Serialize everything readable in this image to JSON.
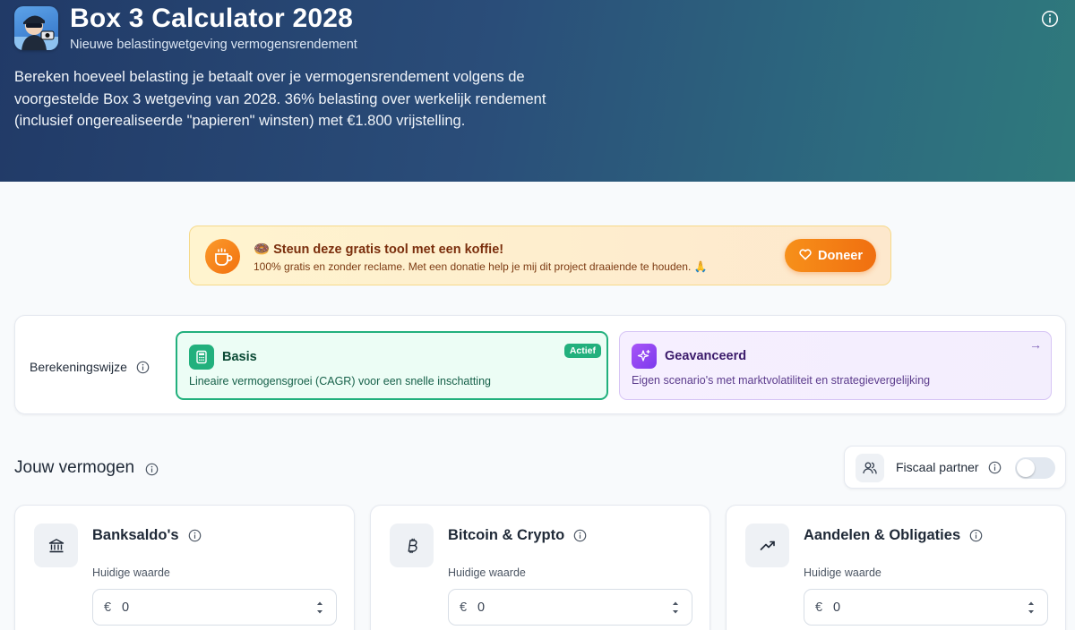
{
  "header": {
    "title": "Box 3 Calculator 2028",
    "subtitle": "Nieuwe belastingwetgeving vermogensrendement",
    "description": "Bereken hoeveel belasting je betaalt over je vermogensrendement volgens de voorgestelde Box 3 wetgeving van 2028. 36% belasting over werkelijk rendement (inclusief ongerealiseerde \"papieren\" winsten) met €1.800 vrijstelling."
  },
  "donation": {
    "title": "🍩 Steun deze gratis tool met een koffie!",
    "text": "100% gratis en zonder reclame. Met een donatie help je mij dit project draaiende te houden. 🙏",
    "button_label": "Doneer"
  },
  "mode": {
    "label": "Berekeningswijze",
    "options": [
      {
        "title": "Basis",
        "description": "Lineaire vermogensgroei (CAGR) voor een snelle inschatting",
        "badge": "Actief"
      },
      {
        "title": "Geavanceerd",
        "description": "Eigen scenario's met marktvolatiliteit en strategievergelijking"
      }
    ]
  },
  "wealth": {
    "title": "Jouw vermogen",
    "partner_label": "Fiscaal partner",
    "partner_enabled": false,
    "assets": [
      {
        "title": "Banksaldo's",
        "field_label": "Huidige waarde",
        "currency": "€",
        "value": "0",
        "icon": "bank-icon"
      },
      {
        "title": "Bitcoin & Crypto",
        "field_label": "Huidige waarde",
        "currency": "€",
        "value": "0",
        "icon": "bitcoin-icon"
      },
      {
        "title": "Aandelen & Obligaties",
        "field_label": "Huidige waarde",
        "currency": "€",
        "value": "0",
        "icon": "trending-up-icon"
      }
    ]
  },
  "colors": {
    "hero_start": "#213a67",
    "hero_end": "#2f7a7c",
    "active_green": "#22b07d",
    "advanced_purple": "#7c3aed",
    "donate_orange": "#f2710f"
  }
}
